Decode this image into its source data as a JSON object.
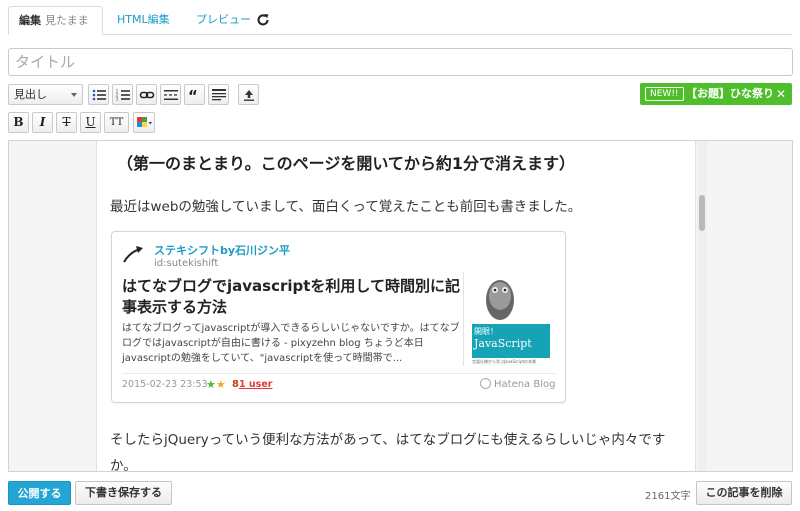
{
  "tabs": {
    "edit_label": "編集",
    "edit_sub": "見たまま",
    "html_label": "HTML編集",
    "preview_label": "プレビュー"
  },
  "title_input": {
    "placeholder": "タイトル",
    "value": ""
  },
  "toolbar": {
    "heading_select": "見出し",
    "bold": "B",
    "italic": "I",
    "strike": "T",
    "underline": "U",
    "font_size": "TT"
  },
  "promo": {
    "new_label": "NEW!!",
    "text": "【お題】ひな祭り",
    "close": "✕"
  },
  "content": {
    "heading": "（第一のまとまり。このページを開いてから約1分で消えます）",
    "para1": "最近はwebの勉強していまして、面白くって覚えたことも前回も書きました。",
    "para2": "そしたらjQueryっていう便利な方法があって、はてなブログにも使えるらしいじゃ内々ですか。"
  },
  "card": {
    "blog_name": "ステキシフトby石川ジン平",
    "blog_id": "id:sutekishift",
    "title": "はてなブログでjavascriptを利用して時間別に記事表示する方法",
    "desc": "はてなブログってjavascriptが導入できるらしいじゃないですか。はてなブログではjavascriptが自由に書ける - pixyzehn blog ちょうど本日javascriptの勉強をしていて、\"javascriptを使って時間帯で...",
    "date": "2015-02-23 23:53",
    "star_count": "8",
    "users": "1 user",
    "source": "Hatena Blog",
    "thumb_title1": "開眼！",
    "thumb_title2": "JavaScript",
    "thumb_sub": "言語仕様から学ぶJavaScriptの本質"
  },
  "footer": {
    "publish": "公開する",
    "draft": "下書き保存する",
    "char_count": "2161文字",
    "delete": "この記事を削除"
  },
  "colors": {
    "accent": "#1a9dc6",
    "publish": "#23a6d5",
    "promo": "#4fbe2c"
  }
}
